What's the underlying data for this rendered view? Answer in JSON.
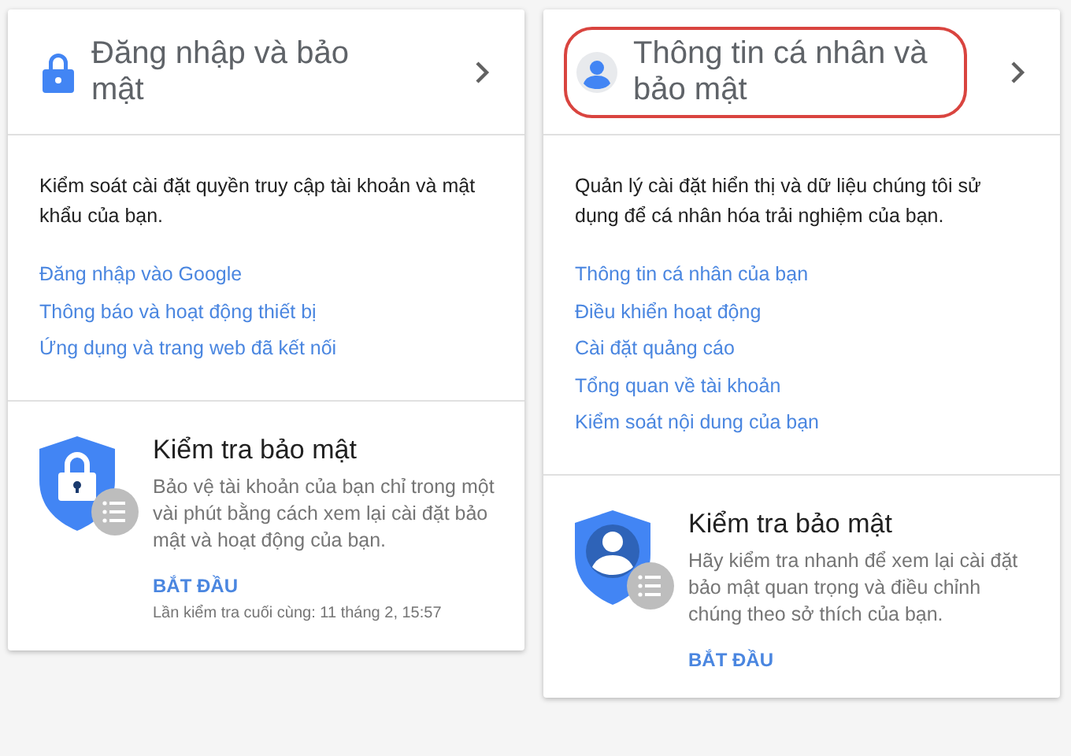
{
  "cards": [
    {
      "kind": "lock",
      "title": "Đăng nhập và bảo mật",
      "highlighted": false,
      "description": "Kiểm soát cài đặt quyền truy cập tài khoản và mật khẩu của bạn.",
      "links": [
        "Đăng nhập vào Google",
        "Thông báo và hoạt động thiết bị",
        "Ứng dụng và trang web đã kết nối"
      ],
      "checkup": {
        "title": "Kiểm tra bảo mật",
        "body": "Bảo vệ tài khoản của bạn chỉ trong một vài phút bằng cách xem lại cài đặt bảo mật và hoạt động của bạn.",
        "action": "BẮT ĐẦU",
        "last_check": "Lần kiểm tra cuối cùng: 11 tháng 2, 15:57"
      }
    },
    {
      "kind": "person",
      "title": "Thông tin cá nhân và bảo mật",
      "highlighted": true,
      "description": "Quản lý cài đặt hiển thị và dữ liệu chúng tôi sử dụng để cá nhân hóa trải nghiệm của bạn.",
      "links": [
        "Thông tin cá nhân của bạn",
        "Điều khiển hoạt động",
        "Cài đặt quảng cáo",
        "Tổng quan về tài khoản",
        "Kiểm soát nội dung của bạn"
      ],
      "checkup": {
        "title": "Kiểm tra bảo mật",
        "body": "Hãy kiểm tra nhanh để xem lại cài đặt bảo mật quan trọng và điều chỉnh chúng theo sở thích của bạn.",
        "action": "BẮT ĐẦU"
      }
    }
  ]
}
